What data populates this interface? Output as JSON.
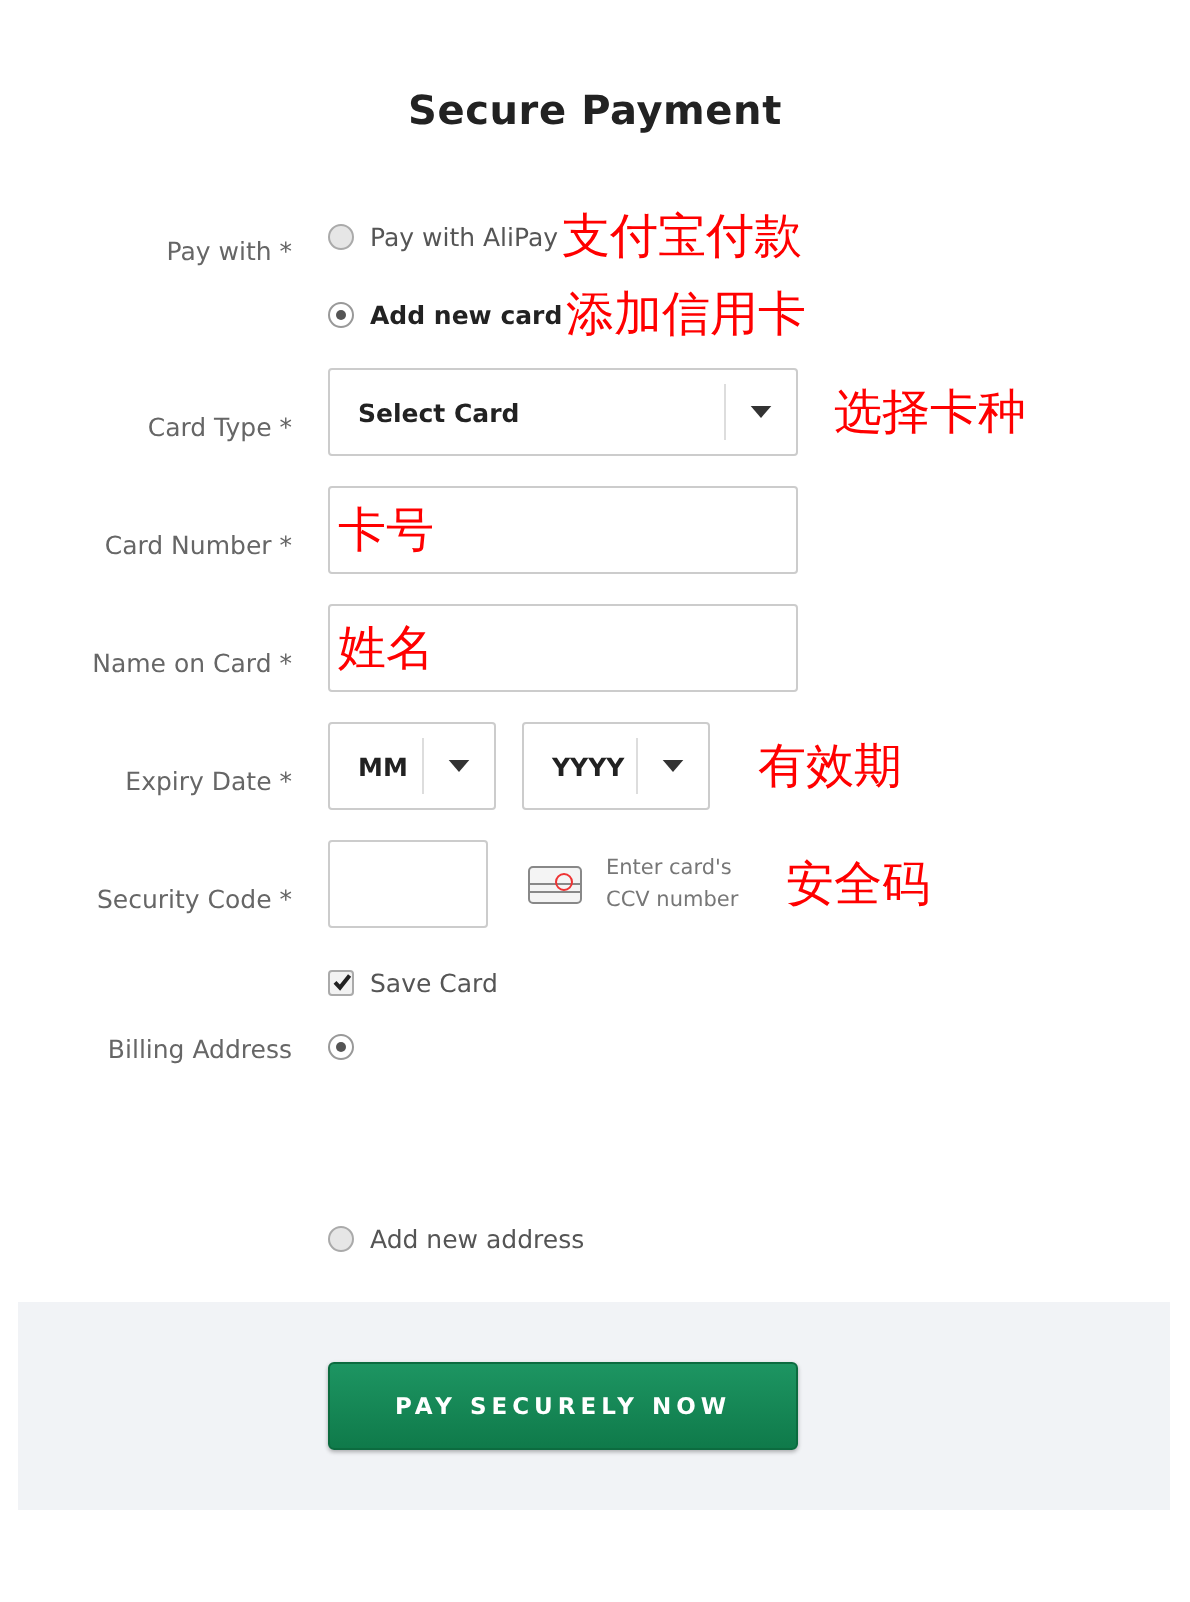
{
  "title": "Secure Payment",
  "pay_with": {
    "label": "Pay with *",
    "options": [
      {
        "label": "Pay with AliPay",
        "selected": false,
        "note": "支付宝付款"
      },
      {
        "label": "Add new card",
        "selected": true,
        "note": "添加信用卡"
      }
    ]
  },
  "fields": [
    {
      "kind": "select",
      "label": "Card Type *",
      "value": "Select Card",
      "note": "选择卡种"
    },
    {
      "kind": "text",
      "label": "Card Number *",
      "note": "卡号"
    },
    {
      "kind": "text",
      "label": "Name on Card *",
      "note": "姓名"
    },
    {
      "kind": "expiry",
      "label": "Expiry Date *",
      "selects": [
        "MM",
        "YYYY"
      ],
      "note": "有效期"
    },
    {
      "kind": "cvv",
      "label": "Security Code *",
      "hint": "Enter card's CCV number",
      "note": "安全码"
    }
  ],
  "save_card": {
    "label": "Save Card",
    "checked": true
  },
  "billing": {
    "label": "Billing Address",
    "options": [
      {
        "selected": true
      },
      {
        "label": "Add new address",
        "selected": false
      }
    ]
  },
  "pay_button": "PAY SECURELY NOW"
}
